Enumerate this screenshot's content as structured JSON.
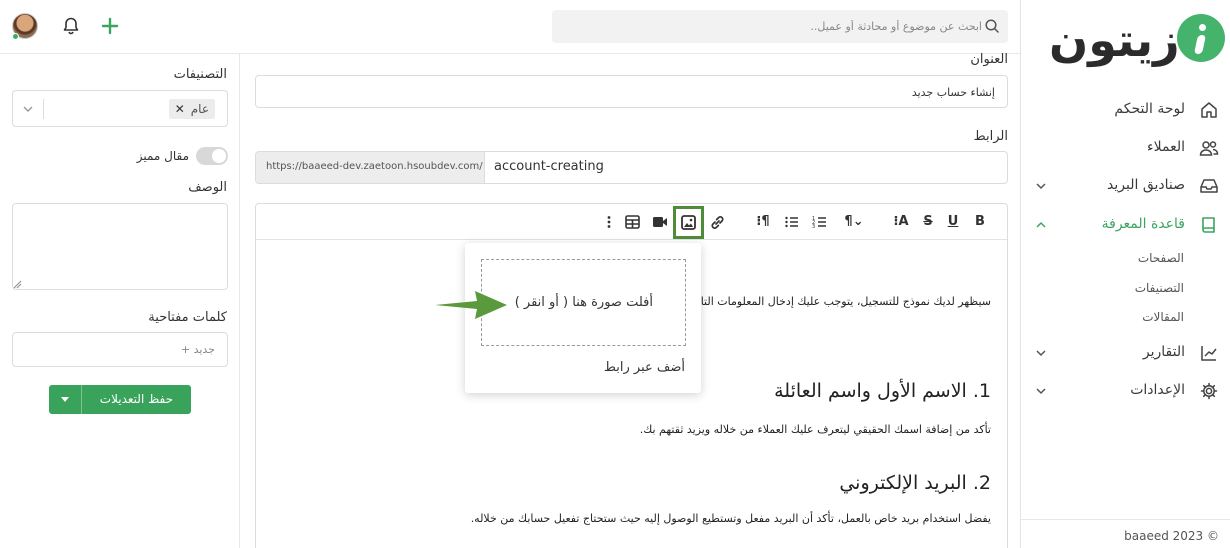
{
  "app": {
    "brand": "زيتون",
    "footer": "baaeed 2023 ©"
  },
  "nav": {
    "items": [
      {
        "label": "لوحة التحكم",
        "icon": "home-icon",
        "active": false,
        "has_chevron": false
      },
      {
        "label": "العملاء",
        "icon": "users-icon",
        "active": false,
        "has_chevron": false
      },
      {
        "label": "صناديق البريد",
        "icon": "inbox-icon",
        "active": false,
        "has_chevron": true
      },
      {
        "label": "قاعدة المعرفة",
        "icon": "book-icon",
        "active": true,
        "has_chevron": true
      },
      {
        "label": "التقارير",
        "icon": "chart-icon",
        "active": false,
        "has_chevron": true
      },
      {
        "label": "الإعدادات",
        "icon": "gear-icon",
        "active": false,
        "has_chevron": true
      }
    ],
    "subitems": [
      "الصفحات",
      "التصنيفات",
      "المقالات"
    ]
  },
  "topbar": {
    "search_placeholder": "ابحث عن موضوع أو محادثة أو عميل.."
  },
  "form": {
    "title_label": "العنوان",
    "title_value": "إنشاء حساب جديد",
    "url_label": "الرابط",
    "url_prefix": "https://baaeed-dev.zaetoon.hsoubdev.com/",
    "url_slug": "account-creating"
  },
  "side": {
    "categories_label": "التصنيفات",
    "category_tag": "عام",
    "featured_label": "مقال مميز",
    "description_label": "الوصف",
    "keywords_label": "كلمات مفتاحية",
    "keywords_placeholder": "+ جديد",
    "save_label": "حفظ التعديلات"
  },
  "editor": {
    "toolbar": [
      "B",
      "U",
      "S",
      "A",
      "¶",
      "ordered-list",
      "bullet-list",
      "rtl",
      "link",
      "image",
      "video",
      "table",
      "more"
    ],
    "intro": "سيظهر لديك نموذج للتسجيل، يتوجب عليك إدخال المعلومات التا",
    "h1": "1. الاسم الأول واسم العائلة",
    "p1": "تأكد من إضافة اسمك الحقيقي ليتعرف عليك العملاء من خلاله ويزيد ثقتهم بك.",
    "h2": "2. البريد الإلكتروني",
    "p2": "يفضل استخدام بريد خاص بالعمل، تأكد أن البريد مفعل وتستطيع الوصول إليه حيث ستحتاج تفعيل حسابك من خلاله."
  },
  "image_popover": {
    "dropzone_text": "أفلت صورة هنا ( أو انقر )",
    "add_link": "أضف عبر رابط"
  },
  "colors": {
    "brand_green": "#45b36b",
    "highlight_border": "#4f8c3a",
    "save_button": "#3aa35b"
  }
}
